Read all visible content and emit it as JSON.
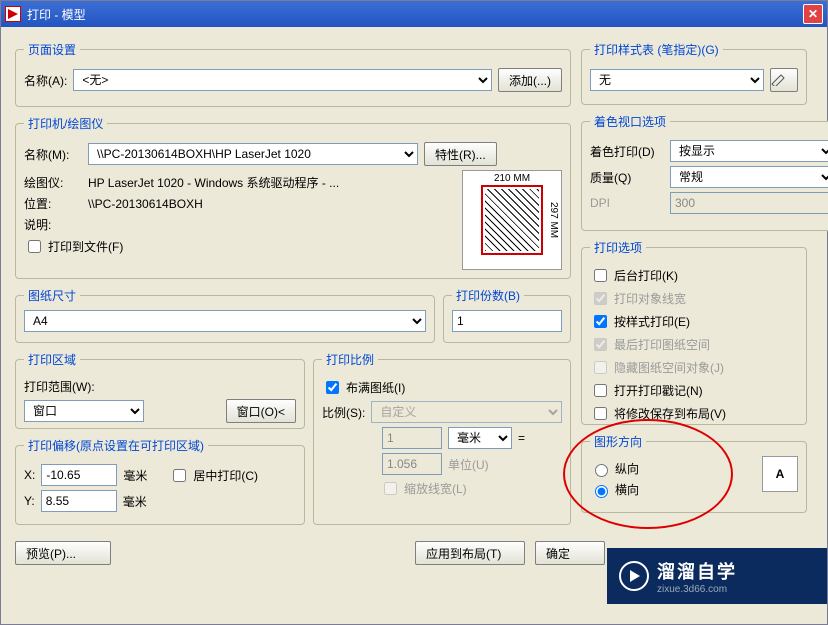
{
  "title": "打印 - 模型",
  "page_setup": {
    "legend": "页面设置",
    "name_lbl": "名称(A):",
    "name_val": "<无>",
    "add_btn": "添加(...)"
  },
  "printer": {
    "legend": "打印机/绘图仪",
    "name_lbl": "名称(M):",
    "name_val": "\\\\PC-20130614BOXH\\HP LaserJet 1020",
    "props_btn": "特性(R)...",
    "plotter_lbl": "绘图仪:",
    "plotter_val": "HP LaserJet 1020 - Windows 系统驱动程序 - ...",
    "where_lbl": "位置:",
    "where_val": "\\\\PC-20130614BOXH",
    "desc_lbl": "说明:",
    "desc_val": "",
    "tofile_lbl": "打印到文件(F)",
    "preview_top": "210 MM",
    "preview_side": "297 MM"
  },
  "paper": {
    "legend": "图纸尺寸",
    "value": "A4"
  },
  "copies": {
    "legend": "打印份数(B)",
    "value": "1"
  },
  "area": {
    "legend": "打印区域",
    "scope_lbl": "打印范围(W):",
    "scope_val": "窗口",
    "window_btn": "窗口(O)<"
  },
  "scale": {
    "legend": "打印比例",
    "fit_lbl": "布满图纸(I)",
    "scale_lbl": "比例(S):",
    "scale_val": "自定义",
    "num1": "1",
    "unit1": "毫米",
    "eq": "=",
    "num2": "1.056",
    "unit2": "单位(U)",
    "lw_lbl": "缩放线宽(L)"
  },
  "offset": {
    "legend": "打印偏移(原点设置在可打印区域)",
    "x_lbl": "X:",
    "x_val": "-10.65",
    "x_unit": "毫米",
    "center_lbl": "居中打印(C)",
    "y_lbl": "Y:",
    "y_val": "8.55",
    "y_unit": "毫米"
  },
  "style": {
    "legend": "打印样式表 (笔指定)(G)",
    "value": "无"
  },
  "shaded": {
    "legend": "着色视口选项",
    "mode_lbl": "着色打印(D)",
    "mode_val": "按显示",
    "quality_lbl": "质量(Q)",
    "quality_val": "常规",
    "dpi_lbl": "DPI",
    "dpi_val": "300"
  },
  "options": {
    "legend": "打印选项",
    "o1": "后台打印(K)",
    "o2": "打印对象线宽",
    "o3": "按样式打印(E)",
    "o4": "最后打印图纸空间",
    "o5": "隐藏图纸空间对象(J)",
    "o6": "打开打印戳记(N)",
    "o7": "将修改保存到布局(V)"
  },
  "orient": {
    "legend": "图形方向",
    "r1": "纵向",
    "r2": "横向"
  },
  "buttons": {
    "preview": "预览(P)...",
    "apply": "应用到布局(T)",
    "ok": "确定"
  },
  "watermark": {
    "brand": "溜溜自学",
    "url": "zixue.3d66.com"
  }
}
